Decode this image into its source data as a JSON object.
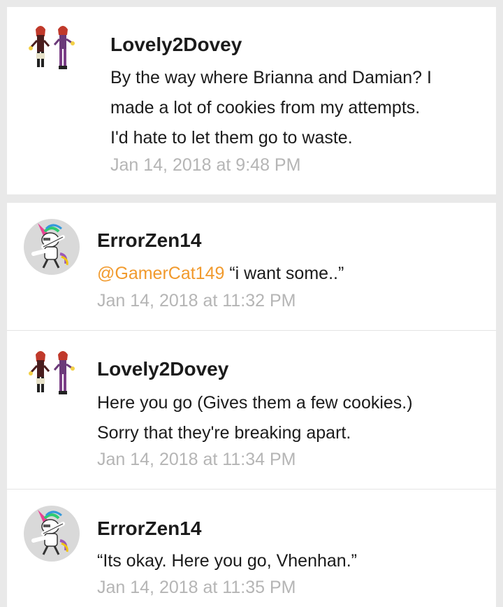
{
  "messages": [
    {
      "author": "Lovely2Dovey",
      "avatar": "girls-avatar-icon",
      "lines": [
        "By the way where Brianna and Damian? I",
        "made a lot of cookies from my attempts.",
        "I'd hate to let them go to waste."
      ],
      "timestamp": "Jan 14, 2018 at 9:48 PM"
    },
    {
      "author": "ErrorZen14",
      "avatar": "dabbing-unicorn-icon",
      "mention": "@GamerCat149",
      "text": " “i want some..”",
      "timestamp": "Jan 14, 2018 at 11:32 PM"
    },
    {
      "author": "Lovely2Dovey",
      "avatar": "girls-avatar-icon",
      "lines": [
        "Here you go (Gives them a few cookies.)",
        "Sorry that they're breaking apart."
      ],
      "timestamp": "Jan 14, 2018 at 11:34 PM"
    },
    {
      "author": "ErrorZen14",
      "avatar": "dabbing-unicorn-icon",
      "lines": [
        "“Its okay. Here you go, Vhenhan.”"
      ],
      "timestamp": "Jan 14, 2018 at 11:35 PM"
    }
  ],
  "colors": {
    "background": "#e9e9e9",
    "card": "#ffffff",
    "text": "#1b1b1b",
    "mention": "#f19a2d",
    "timestamp": "#b5b5b5"
  }
}
